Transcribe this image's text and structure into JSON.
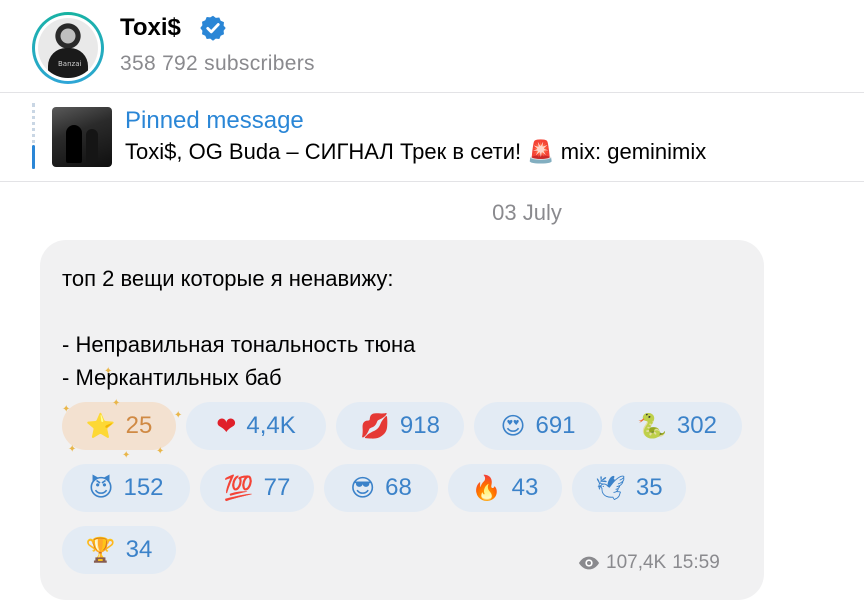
{
  "channel": {
    "name": "Toxi$",
    "subscribers": "358 792 subscribers",
    "avatar_logo": "Banzai"
  },
  "pinned": {
    "label": "Pinned message",
    "text": "Toxi$, OG Buda – СИГНАЛ  Трек в сети! 🚨  mix: geminimix"
  },
  "date_separator": "03 July",
  "message": {
    "text": "топ 2 вещи которые я ненавижу:\n\n- Неправильная тональность тюна\n- Меркантильных баб",
    "views": "107,4K",
    "time": "15:59"
  },
  "reactions": [
    {
      "emoji": "⭐",
      "count": "25",
      "icon": "star-icon"
    },
    {
      "emoji": "❤",
      "count": "4,4K",
      "icon": "heart-icon"
    },
    {
      "emoji": "💋",
      "count": "918",
      "icon": "kiss-icon"
    },
    {
      "emoji": "😍",
      "count": "691",
      "icon": "heart-eyes-icon"
    },
    {
      "emoji": "🐍",
      "count": "302",
      "icon": "snake-icon"
    },
    {
      "emoji": "😈",
      "count": "152",
      "icon": "devil-icon"
    },
    {
      "emoji": "💯",
      "count": "77",
      "icon": "hundred-icon"
    },
    {
      "emoji": "😎",
      "count": "68",
      "icon": "sunglasses-icon"
    },
    {
      "emoji": "🔥",
      "count": "43",
      "icon": "fire-icon"
    },
    {
      "emoji": "🕊",
      "count": "35",
      "icon": "dove-icon"
    },
    {
      "emoji": "🏆",
      "count": "34",
      "icon": "trophy-icon"
    }
  ],
  "colors": {
    "accent": "#2a86d6",
    "reaction_bg": "#e3ebf4",
    "reaction_text": "#3b82c9",
    "paid_reaction_bg": "#f3e1d0",
    "paid_reaction_text": "#d08a44",
    "bubble_bg": "#f1f1f2",
    "muted": "#8a8a8e"
  }
}
